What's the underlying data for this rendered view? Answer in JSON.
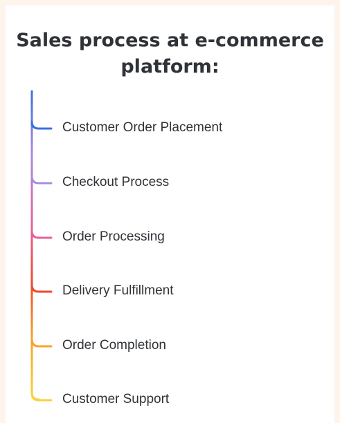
{
  "title": "Sales process at e-commerce platform:",
  "items": [
    {
      "label": "Customer Order Placement",
      "color": "#3b6fe0"
    },
    {
      "label": "Checkout Process",
      "color": "#a98be0"
    },
    {
      "label": "Order Processing",
      "color": "#ea6098"
    },
    {
      "label": "Delivery Fulfillment",
      "color": "#ee4a2c"
    },
    {
      "label": "Order Completion",
      "color": "#f7a32a"
    },
    {
      "label": "Customer Support",
      "color": "#f8d23e"
    }
  ]
}
